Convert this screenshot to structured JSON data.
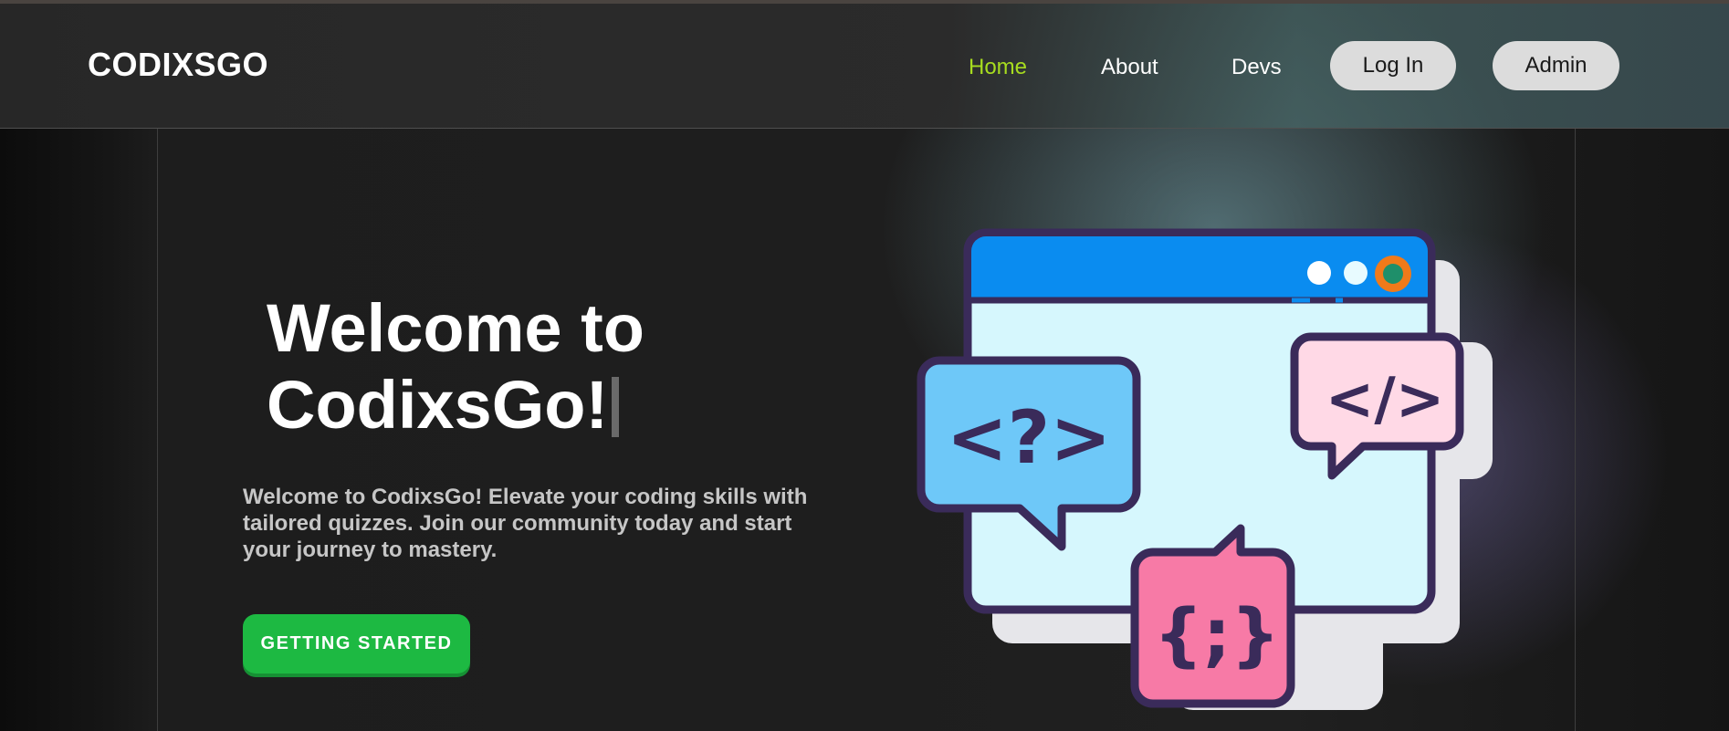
{
  "brand": {
    "logo": "CODIXSGO"
  },
  "nav": {
    "home": "Home",
    "about": "About",
    "devs": "Devs",
    "login": "Log In",
    "admin": "Admin"
  },
  "hero": {
    "title_line1": "Welcome to",
    "title_line2": "CodixsGo!",
    "description": "Welcome to CodixsGo! Elevate your coding skills with tailored quizzes. Join our community today and start your journey to mastery.",
    "cta": "GETTING STARTED"
  },
  "illustration": {
    "bubble_question": "<?>",
    "bubble_code": "</>",
    "bubble_braces": "{;}"
  },
  "colors": {
    "accent_active_nav": "#a7dc1f",
    "cta_green": "#1db942",
    "pill_bg": "#dcdcdc"
  }
}
